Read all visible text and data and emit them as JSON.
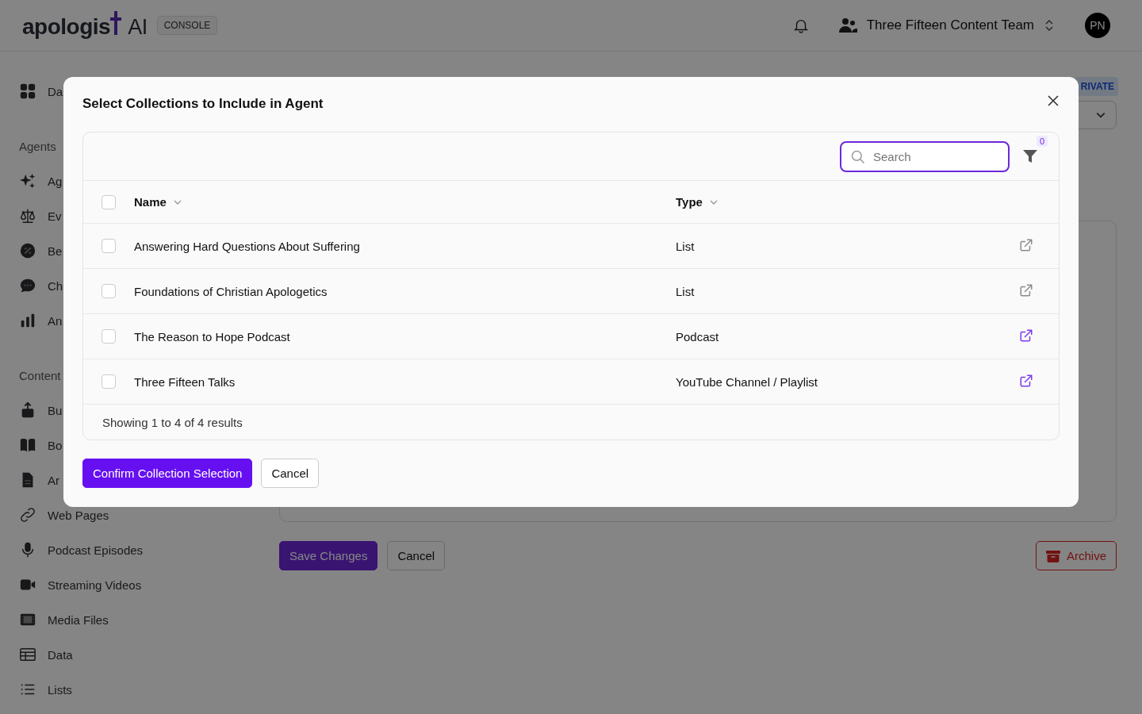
{
  "header": {
    "wordmark": "apologis",
    "suffix": "AI",
    "badge": "CONSOLE",
    "team": "Three Fifteen Content Team",
    "avatar": "PN"
  },
  "sidebar": {
    "top": [
      {
        "label": "Da"
      }
    ],
    "sections": [
      {
        "title": "Agents",
        "items": [
          {
            "label": "Ag"
          },
          {
            "label": "Ev"
          },
          {
            "label": "Be"
          },
          {
            "label": "Ch"
          },
          {
            "label": "An"
          }
        ]
      },
      {
        "title": "Content",
        "items": [
          {
            "label": "Bu"
          },
          {
            "label": "Bo"
          },
          {
            "label": "Ar"
          },
          {
            "label": "Web Pages"
          },
          {
            "label": "Podcast Episodes"
          },
          {
            "label": "Streaming Videos"
          },
          {
            "label": "Media Files"
          },
          {
            "label": "Data"
          },
          {
            "label": "Lists"
          }
        ]
      }
    ]
  },
  "main": {
    "visibility_badge": "RIVATE",
    "save": "Save Changes",
    "cancel": "Cancel",
    "archive": "Archive"
  },
  "modal": {
    "title": "Select Collections to Include in Agent",
    "search": {
      "placeholder": "Search"
    },
    "filter_count": "0",
    "select_all": {
      "checked": false
    },
    "columns": [
      "Name",
      "Type"
    ],
    "rows": [
      {
        "name": "Answering Hard Questions About Suffering",
        "type": "List",
        "checked": false,
        "link_active": false
      },
      {
        "name": "Foundations of Christian Apologetics",
        "type": "List",
        "checked": false,
        "link_active": false
      },
      {
        "name": "The Reason to Hope Podcast",
        "type": "Podcast",
        "checked": false,
        "link_active": true
      },
      {
        "name": "Three Fifteen Talks",
        "type": "YouTube Channel / Playlist",
        "checked": false,
        "link_active": true
      }
    ],
    "footer": "Showing 1 to 4 of 4 results",
    "confirm": "Confirm Collection Selection",
    "cancel": "Cancel"
  }
}
